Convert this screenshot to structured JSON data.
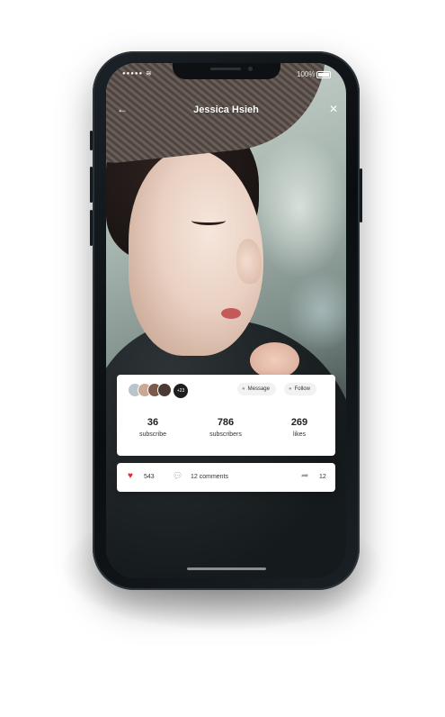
{
  "status_bar": {
    "signal": "●●●●●",
    "wifi": "≋",
    "battery_percent": "100%"
  },
  "nav": {
    "back_icon": "←",
    "title": "Jessica Hsieh",
    "close_icon": "✕"
  },
  "profile_card": {
    "avatars_more": "+23",
    "message_label": "Message",
    "follow_label": "Follow",
    "stats": [
      {
        "value": "36",
        "label": "subscribe"
      },
      {
        "value": "786",
        "label": "subscribers"
      },
      {
        "value": "269",
        "label": "likes"
      }
    ]
  },
  "engagement_bar": {
    "likes": "543",
    "comments": "12 comments",
    "shares": "12"
  },
  "colors": {
    "heart": "#e0293c",
    "card_bg": "#ffffff"
  }
}
